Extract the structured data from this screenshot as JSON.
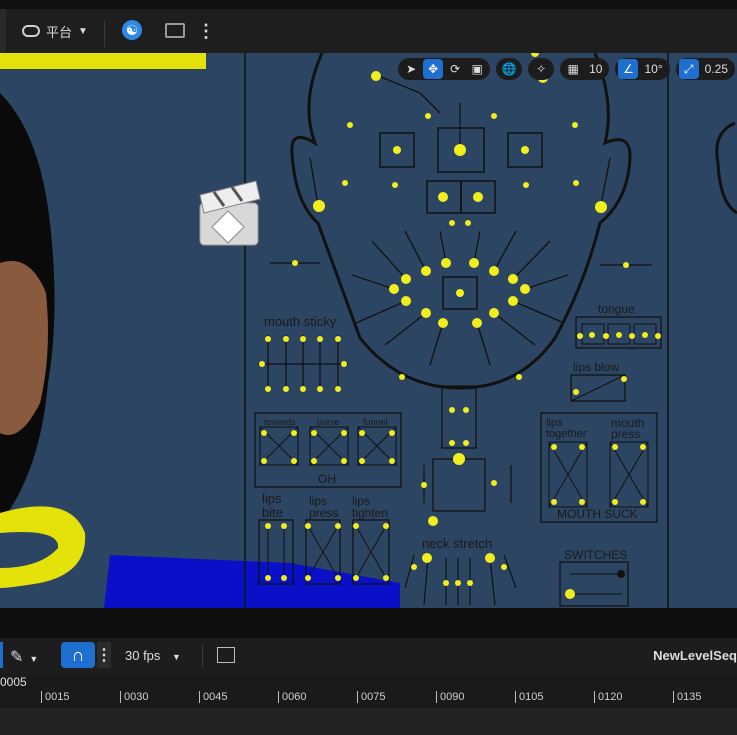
{
  "topbar": {
    "platform_label": "平台",
    "more_label": "⋮"
  },
  "viewport_tools": {
    "grid_snap_value": "10",
    "angle_snap_value": "10°",
    "scale_snap_value": "0.25"
  },
  "face_rig": {
    "mouth_sticky_label": "mouth sticky",
    "tongue_label": "tongue",
    "lips_blow_label": "lips blow",
    "towards_label": "towards",
    "purse_label": "purse",
    "funnel_label": "funnel",
    "oh_label": "OH",
    "lips_together_label_1": "lips",
    "lips_together_label_2": "together",
    "mouth_press_label_1": "mouth",
    "mouth_press_label_2": "press",
    "mouth_suck_label": "MOUTH SUCK",
    "lips_bite_label_1": "lips",
    "lips_bite_label_2": "bite",
    "lips_press_label_1": "lips",
    "lips_press_label_2": "press",
    "lips_tighten_label_1": "lips",
    "lips_tighten_label_2": "tighten",
    "neck_stretch_label": "neck stretch",
    "switches_label": "SWITCHES"
  },
  "sequencer": {
    "fps_label": "30 fps",
    "sequence_name": "NewLevelSeq",
    "current_frame": "0005",
    "ruler_ticks": [
      "0015",
      "0030",
      "0045",
      "0060",
      "0075",
      "0090",
      "0105",
      "0120",
      "0135"
    ]
  },
  "colors": {
    "accent_blue": "#1f6fd1",
    "control_yellow": "#f2ee1e",
    "viewport_bg": "#2c4563"
  }
}
